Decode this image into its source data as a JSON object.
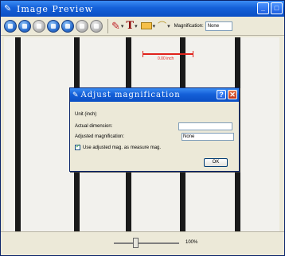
{
  "window": {
    "title": "Image Preview",
    "icon": "pencil-ruler-icon",
    "buttons": [
      "minimize-icon",
      "maximize-icon"
    ]
  },
  "toolbar": {
    "round_buttons": [
      "capture-icon",
      "record-icon",
      "stop-icon",
      "camera-icon",
      "settings-icon",
      "prev-icon",
      "next-icon"
    ],
    "magnification_label": "Magnification:",
    "magnification_value": "None"
  },
  "image": {
    "measurement_label": "0.00 inch"
  },
  "status": {
    "zoom": "100%"
  },
  "dialog": {
    "title": "Adjust magnification",
    "unit_label": "Unit (inch)",
    "actual_dimension_label": "Actual dimension:",
    "actual_dimension_value": "",
    "adjusted_magnification_label": "Adjusted magnification:",
    "adjusted_magnification_value": "None",
    "checkbox_label": "Use adjusted mag. as measure mag.",
    "checkbox_checked": true,
    "ok_label": "OK"
  },
  "colors": {
    "title_blue": "#1460d8",
    "measure_red": "#e0231c"
  }
}
